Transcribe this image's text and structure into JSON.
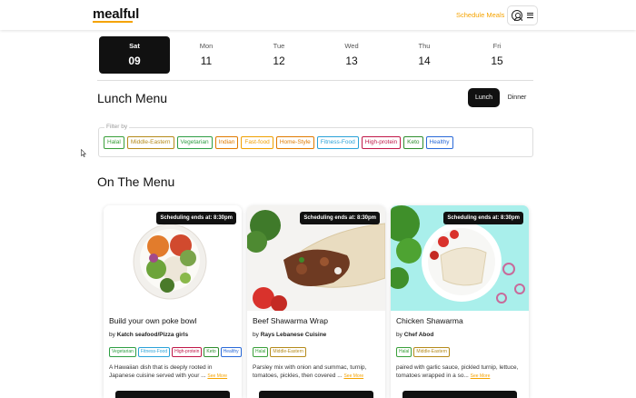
{
  "app": {
    "logo": "mealful"
  },
  "header": {
    "schedule_link": "Schedule Meals"
  },
  "days": [
    {
      "name": "Sat",
      "num": "09",
      "active": true
    },
    {
      "name": "Mon",
      "num": "11"
    },
    {
      "name": "Tue",
      "num": "12"
    },
    {
      "name": "Wed",
      "num": "13"
    },
    {
      "name": "Thu",
      "num": "14"
    },
    {
      "name": "Fri",
      "num": "15"
    }
  ],
  "meal": {
    "title": "Lunch Menu",
    "lunch_label": "Lunch",
    "dinner_label": "Dinner"
  },
  "filter": {
    "legend": "Filter by",
    "chips": [
      {
        "label": "Halal",
        "color": "#3aa03a"
      },
      {
        "label": "Middle-Eastern",
        "color": "#b58a1a"
      },
      {
        "label": "Vegetarian",
        "color": "#2e9e44"
      },
      {
        "label": "Indian",
        "color": "#e07a00"
      },
      {
        "label": "Fast-food",
        "color": "#f0a000"
      },
      {
        "label": "Home-Style",
        "color": "#e07a00"
      },
      {
        "label": "Fitness-Food",
        "color": "#2aa2d8"
      },
      {
        "label": "High-protein",
        "color": "#c01848"
      },
      {
        "label": "Keto",
        "color": "#2e8e2e"
      },
      {
        "label": "Healthy",
        "color": "#2a6ad8"
      }
    ]
  },
  "section": {
    "title": "On The Menu"
  },
  "cards": [
    {
      "badge": "Scheduling ends at: 8:30pm",
      "name": "Build your own poke bowl",
      "vendor_prefix": "by",
      "vendor": "Katch seafood/Pizza girls",
      "tags": [
        {
          "label": "Vegetarian",
          "color": "#2e9e44"
        },
        {
          "label": "Fitness-Food",
          "color": "#2aa2d8"
        },
        {
          "label": "High-protein",
          "color": "#c01848"
        },
        {
          "label": "Keto",
          "color": "#2e8e2e"
        },
        {
          "label": "Healthy",
          "color": "#2a6ad8"
        }
      ],
      "desc": "A Hawaiian dish that is deeply rooted in Japanese cuisine served with your ...",
      "see_more": "See More"
    },
    {
      "badge": "Scheduling ends at: 8:30pm",
      "name": "Beef Shawarma Wrap",
      "vendor_prefix": "by",
      "vendor": "Rays Lebanese Cuisine",
      "tags": [
        {
          "label": "Halal",
          "color": "#3aa03a"
        },
        {
          "label": "Middle-Eastern",
          "color": "#b58a1a"
        }
      ],
      "desc": "Parsley mix with onion and summac, turnip, tomatoes, pickles, then covered ...",
      "see_more": "See More"
    },
    {
      "badge": "Scheduling ends at: 8:30pm",
      "name": "Chicken Shawarma",
      "vendor_prefix": "by",
      "vendor": "Chef Abod",
      "tags": [
        {
          "label": "Halal",
          "color": "#3aa03a"
        },
        {
          "label": "Middle-Eastern",
          "color": "#b58a1a"
        }
      ],
      "desc": "paired with garlic sauce, pickled turnip, lettuce, tomatoes wrapped in a so...",
      "see_more": "See More"
    }
  ],
  "colors": {
    "accent": "#f5a300",
    "dark": "#111111"
  }
}
